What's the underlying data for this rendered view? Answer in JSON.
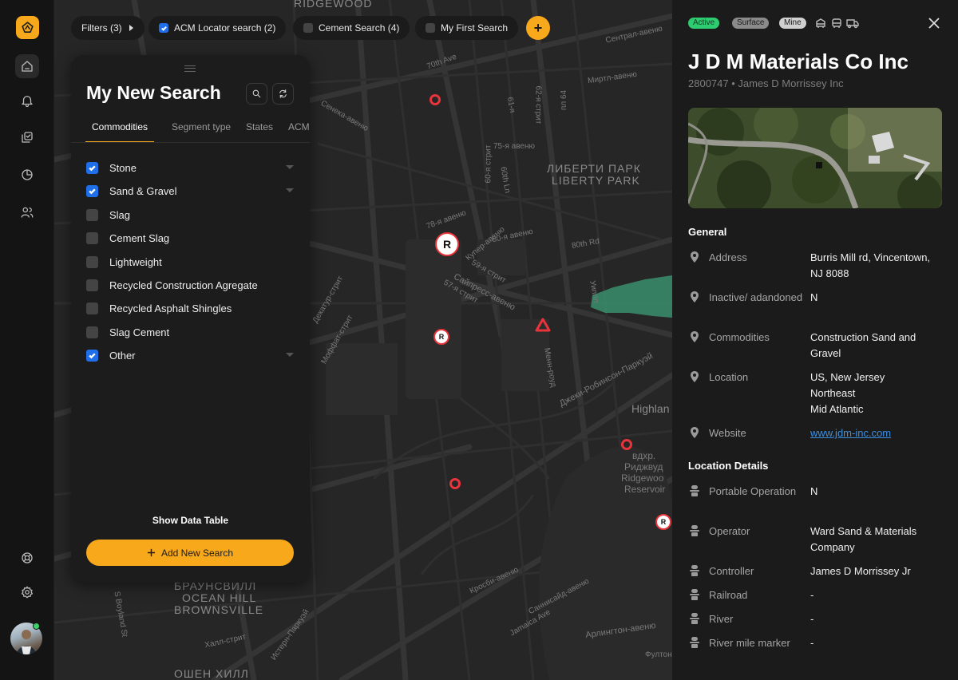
{
  "filters": [
    {
      "label": "Filters (3)",
      "checkbox": null
    },
    {
      "label": "ACM Locator search (2)",
      "checkbox": true
    },
    {
      "label": "Cement Search (4)",
      "checkbox": false
    },
    {
      "label": "My First Search",
      "checkbox": false
    }
  ],
  "add_chip_label": "+",
  "map_labels": {
    "ridgewood": "RIDGEWOOD",
    "liberty_park_ru": "ЛИБЕРТИ ПАРК",
    "liberty_park": "LIBERTY PARK",
    "brownsville_ru": "БРАУНСВИЛЛ",
    "ocean_hill": "OCEAN HILL",
    "brownsville": "BROWNSVILLE",
    "ocean_hill_ru": "ОШЕН ХИЛЛ",
    "highland": "Highlan",
    "reservoir_ru1": "вдхр.",
    "reservoir_ru2": "Риджвуд",
    "reservoir_en1": "Ridgewoo",
    "reservoir_en2": "Reservoir",
    "st_70th": "70th Ave",
    "st_80th": "80th Rd",
    "st_cypress": "Сайпресс-авеню",
    "st_jackie": "Джеки-Робинсон-Паркуэй",
    "st_jamaica": "Jamaica Ave",
    "st_myrtle": "Миртл-авеню",
    "st_central": "Сентрал-авеню",
    "st_senneca": "Сенека-авеню",
    "st_75": "75-я авеню",
    "st_78": "78-я авеню",
    "st_80": "80-я авеню",
    "st_59": "59-я стрит",
    "st_57": "57-я стрит",
    "st_cooper": "Купер-авеню",
    "st_crosby": "Кросби-авеню",
    "st_moffat": "Моффат-стрит",
    "st_dekatur": "Декатур-стрит",
    "st_arlington": "Арлингтон-авеню",
    "st_saracens": "Саннисайд-авеню",
    "st_hall": "Халл-стрит",
    "st_istern": "Истерн-Паркуэй",
    "st_boyland": "S Boyland St",
    "st_fulton": "Фултон",
    "st_menn": "Менн-роуд",
    "st_60": "60-я стрит",
    "st_60th": "60th Ln",
    "st_61": "61-я",
    "st_62": "62-я стрит",
    "st_64": "пл 64",
    "st_uip": "Уиппл"
  },
  "search_panel": {
    "title": "My New Search",
    "tabs": [
      "Commodities",
      "Segment type",
      "States",
      "ACM"
    ],
    "commodities": [
      {
        "label": "Stone",
        "checked": true,
        "expandable": true
      },
      {
        "label": "Sand & Gravel",
        "checked": true,
        "expandable": true
      },
      {
        "label": "Slag",
        "checked": false,
        "expandable": false
      },
      {
        "label": "Cement Slag",
        "checked": false,
        "expandable": false
      },
      {
        "label": "Lightweight",
        "checked": false,
        "expandable": false
      },
      {
        "label": "Recycled Construction Agregate",
        "checked": false,
        "expandable": false
      },
      {
        "label": "Recycled Asphalt Shingles",
        "checked": false,
        "expandable": false
      },
      {
        "label": "Slag Cement",
        "checked": false,
        "expandable": false
      },
      {
        "label": "Other",
        "checked": true,
        "expandable": true
      }
    ],
    "show_data_table": "Show Data Table",
    "add_new_search": "Add New Search"
  },
  "map_pins": [
    {
      "kind": "ring"
    },
    {
      "kind": "R-large",
      "letter": "R"
    },
    {
      "kind": "R-small",
      "letter": "R"
    },
    {
      "kind": "triangle"
    },
    {
      "kind": "ring"
    },
    {
      "kind": "ring"
    },
    {
      "kind": "R-small",
      "letter": "R"
    }
  ],
  "detail": {
    "badges": [
      {
        "label": "Active",
        "bg": "#2ecc71",
        "fg": "#0f3d22"
      },
      {
        "label": "Surface",
        "bg": "#8a8a8a",
        "fg": "#1b1b1b"
      },
      {
        "label": "Mine",
        "bg": "#d0d0d0",
        "fg": "#1b1b1b"
      }
    ],
    "transport_icons": [
      "railcar-icon",
      "bus-icon",
      "truck-icon"
    ],
    "name": "J D M Materials Co Inc",
    "subtitle": "2800747 • James D Morrissey Inc",
    "general_title": "General",
    "general": [
      {
        "label": "Address",
        "value": "Burris Mill rd, Vincentown, NJ 8088",
        "icon": "pin-icon"
      },
      {
        "label": "Inactive/ adandoned",
        "value": "N",
        "icon": "pin-icon"
      },
      {
        "label": "Commodities",
        "value": "Construction Sand and Gravel",
        "icon": "pin-icon"
      },
      {
        "label": "Location",
        "value": "US, New Jersey\nNortheast\nMid Atlantic",
        "icon": "pin-icon"
      },
      {
        "label": "Website",
        "value": "www.jdm-inc.com",
        "icon": "pin-icon",
        "link": true
      }
    ],
    "location_title": "Location Details",
    "location": [
      {
        "label": "Portable Operation",
        "value": "N",
        "icon": "person-icon"
      },
      {
        "label": "Operator",
        "value": "Ward Sand & Materials Company",
        "icon": "person-icon"
      },
      {
        "label": "Controller",
        "value": "James D Morrissey Jr",
        "icon": "person-icon"
      },
      {
        "label": "Railroad",
        "value": "-",
        "icon": "person-icon"
      },
      {
        "label": "River",
        "value": "-",
        "icon": "person-icon"
      },
      {
        "label": "River mile marker",
        "value": "-",
        "icon": "person-icon"
      }
    ]
  },
  "colors": {
    "accent": "#f7a81b",
    "checkbox": "#1f6feb",
    "pin": "#e8343a",
    "link": "#3d8fe0",
    "area": "#3a8f6e"
  }
}
